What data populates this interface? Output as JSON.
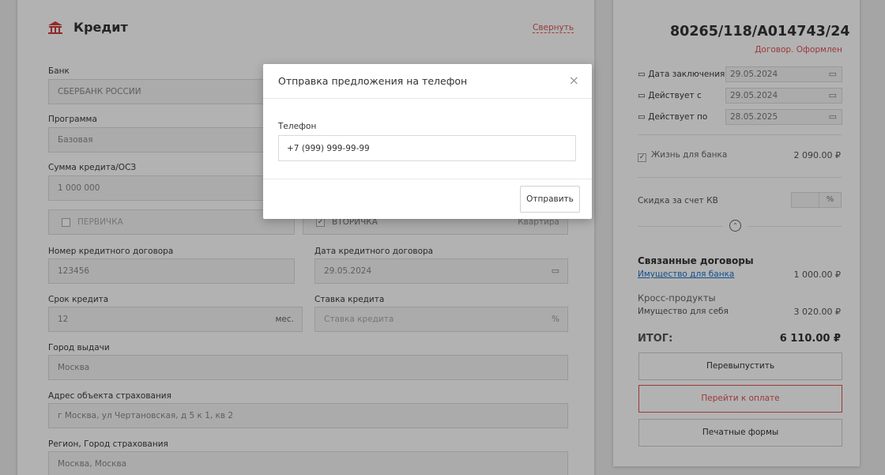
{
  "credit": {
    "title": "Кредит",
    "collapse": "Свернуть",
    "bank_label": "Банк",
    "bank_value": "СБЕРБАНК РОССИИ",
    "program_label": "Программа",
    "program_value": "Базовая",
    "sum_label": "Сумма кредита/ОСЗ",
    "sum_value": "1 000 000",
    "primary_label": "ПЕРВИЧКА",
    "secondary_label": "ВТОРИЧКА",
    "secondary_type": "Квартира",
    "contract_no_label": "Номер кредитного договора",
    "contract_no_value": "123456",
    "contract_date_label": "Дата кредитного договора",
    "contract_date_value": "29.05.2024",
    "term_label": "Срок кредита",
    "term_value": "12",
    "term_unit": "мес.",
    "rate_label": "Ставка кредита",
    "rate_placeholder": "Ставка кредита",
    "rate_unit": "%",
    "city_label": "Город выдачи",
    "city_value": "Москва",
    "address_label": "Адрес объекта страхования",
    "address_value": "г Москва, ул Чертановская, д 5 к 1, кв 2",
    "region_label": "Регион, Город страхования",
    "region_value": "Москва, Москва"
  },
  "contract": {
    "number": "80265/118/A014743/24",
    "status": "Договор. Оформлен",
    "date_concluded_label": "Дата заключения",
    "date_concluded": "29.05.2024",
    "valid_from_label": "Действует с",
    "valid_from": "29.05.2024",
    "valid_to_label": "Действует по",
    "valid_to": "28.05.2025",
    "life_label": "Жизнь для банка",
    "life_amount": "2 090.00 ₽",
    "discount_label": "Скидка за счет КВ",
    "discount_unit": "%",
    "related_title": "Связанные договоры",
    "related_link": "Имущество для банка",
    "related_amount": "1 000.00 ₽",
    "cross_title": "Кросс-продукты",
    "cross_item": "Имущество для себя",
    "cross_amount": "3 020.00 ₽",
    "total_label": "ИТОГ:",
    "total_amount": "6 110.00 ₽",
    "reissue_btn": "Перевыпустить",
    "pay_btn": "Перейти к оплате",
    "print_btn": "Печатные формы"
  },
  "modal": {
    "title": "Отправка предложения на телефон",
    "close": "×",
    "phone_label": "Телефон",
    "phone_value": "+7 (999) 999-99-99",
    "send": "Отправить"
  },
  "colors": {
    "accent_red": "#e05252",
    "link_blue": "#1a73c9",
    "overlay": "rgba(0,0,0,0.3)"
  },
  "icons": {
    "bank": "bank-icon",
    "calendar": "calendar-icon",
    "checkbox": "check-icon",
    "close": "close-icon",
    "collapse": "chevron-up-icon"
  }
}
